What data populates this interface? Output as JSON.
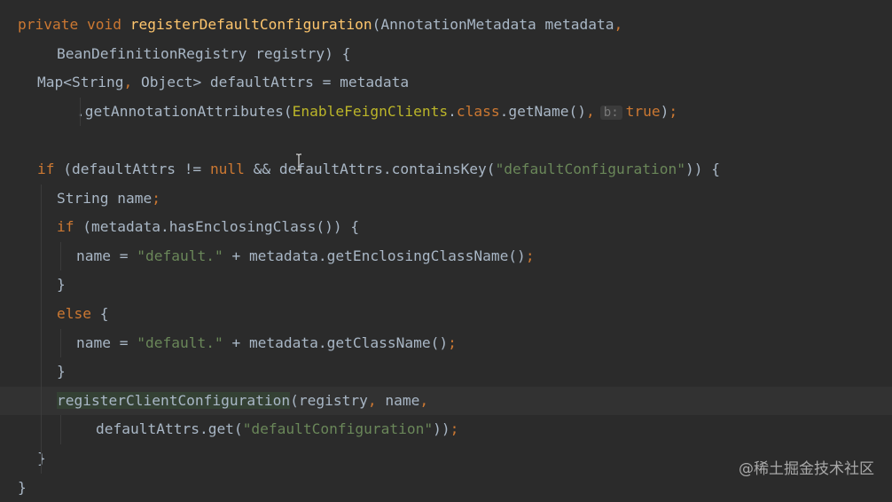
{
  "editor": {
    "lines": [
      {
        "indent": 0,
        "current": false,
        "tokens": [
          {
            "t": "private void ",
            "c": "kw"
          },
          {
            "t": "registerDefaultConfiguration",
            "c": "fn"
          },
          {
            "t": "(AnnotationMetadata metadata",
            "c": "txt"
          },
          {
            "t": ",",
            "c": "kw"
          }
        ]
      },
      {
        "indent": 4,
        "current": false,
        "tokens": [
          {
            "t": "BeanDefinitionRegistry registry) {",
            "c": "txt"
          }
        ]
      },
      {
        "indent": 2,
        "current": false,
        "tokens": [
          {
            "t": "Map<String",
            "c": "txt"
          },
          {
            "t": ", ",
            "c": "kw"
          },
          {
            "t": "Object> defaultAttrs = metadata",
            "c": "txt"
          }
        ]
      },
      {
        "indent": 6,
        "current": false,
        "tokens": [
          {
            "t": ".getAnnotationAttributes(",
            "c": "txt"
          },
          {
            "t": "EnableFeignClients",
            "c": "ann"
          },
          {
            "t": ".",
            "c": "txt"
          },
          {
            "t": "class",
            "c": "kw"
          },
          {
            "t": ".getName()",
            "c": "txt"
          },
          {
            "t": ",",
            "c": "kw"
          },
          {
            "t": "b:",
            "c": "hint"
          },
          {
            "t": "true",
            "c": "kw"
          },
          {
            "t": ")",
            "c": "txt"
          },
          {
            "t": ";",
            "c": "kw"
          }
        ]
      },
      {
        "indent": 0,
        "current": false,
        "tokens": []
      },
      {
        "indent": 2,
        "current": false,
        "tokens": [
          {
            "t": "if ",
            "c": "kw"
          },
          {
            "t": "(defaultAttrs != ",
            "c": "txt"
          },
          {
            "t": "null",
            "c": "kw"
          },
          {
            "t": " && defaultAttrs.containsKey(",
            "c": "txt"
          },
          {
            "t": "\"defaultConfiguration\"",
            "c": "str"
          },
          {
            "t": ")) {",
            "c": "txt"
          }
        ]
      },
      {
        "indent": 4,
        "current": false,
        "tokens": [
          {
            "t": "String name",
            "c": "txt"
          },
          {
            "t": ";",
            "c": "kw"
          }
        ]
      },
      {
        "indent": 4,
        "current": false,
        "tokens": [
          {
            "t": "if ",
            "c": "kw"
          },
          {
            "t": "(metadata.hasEnclosingClass()) {",
            "c": "txt"
          }
        ]
      },
      {
        "indent": 6,
        "current": false,
        "tokens": [
          {
            "t": "name = ",
            "c": "txt"
          },
          {
            "t": "\"default.\"",
            "c": "str"
          },
          {
            "t": " + metadata.getEnclosingClassName()",
            "c": "txt"
          },
          {
            "t": ";",
            "c": "kw"
          }
        ]
      },
      {
        "indent": 4,
        "current": false,
        "tokens": [
          {
            "t": "}",
            "c": "txt"
          }
        ]
      },
      {
        "indent": 4,
        "current": false,
        "tokens": [
          {
            "t": "else ",
            "c": "kw"
          },
          {
            "t": "{",
            "c": "txt"
          }
        ]
      },
      {
        "indent": 6,
        "current": false,
        "tokens": [
          {
            "t": "name = ",
            "c": "txt"
          },
          {
            "t": "\"default.\"",
            "c": "str"
          },
          {
            "t": " + metadata.getClassName()",
            "c": "txt"
          },
          {
            "t": ";",
            "c": "kw"
          }
        ]
      },
      {
        "indent": 4,
        "current": false,
        "tokens": [
          {
            "t": "}",
            "c": "txt"
          }
        ]
      },
      {
        "indent": 4,
        "current": true,
        "tokens": [
          {
            "t": "registerClientConfiguration",
            "c": "hl-call"
          },
          {
            "t": "(registry",
            "c": "txt"
          },
          {
            "t": ", ",
            "c": "kw"
          },
          {
            "t": "name",
            "c": "txt"
          },
          {
            "t": ",",
            "c": "kw"
          }
        ]
      },
      {
        "indent": 8,
        "current": false,
        "tokens": [
          {
            "t": "defaultAttrs.get(",
            "c": "txt"
          },
          {
            "t": "\"defaultConfiguration\"",
            "c": "str"
          },
          {
            "t": "))",
            "c": "txt"
          },
          {
            "t": ";",
            "c": "kw"
          }
        ]
      },
      {
        "indent": 2,
        "current": false,
        "tokens": [
          {
            "t": "}",
            "c": "txt"
          }
        ]
      },
      {
        "indent": 0,
        "current": false,
        "tokens": [
          {
            "t": "}",
            "c": "txt"
          }
        ]
      }
    ]
  },
  "watermark": {
    "text": "@稀土掘金技术社区"
  },
  "cursor": {
    "icon": "text-cursor-icon"
  }
}
